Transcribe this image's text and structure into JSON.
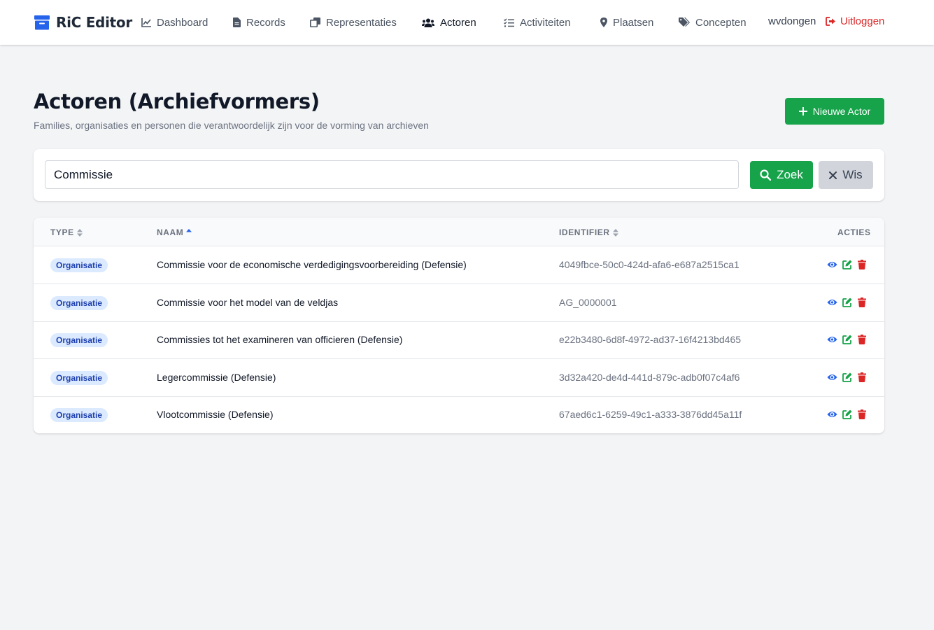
{
  "app": {
    "name": "RiC Editor"
  },
  "nav": {
    "items": [
      {
        "label": "Dashboard",
        "icon": "chart-line-icon"
      },
      {
        "label": "Records",
        "icon": "file-icon"
      },
      {
        "label": "Representaties",
        "icon": "copy-icon"
      },
      {
        "label": "Actoren",
        "icon": "users-icon",
        "active": true
      },
      {
        "label": "Activiteiten",
        "icon": "tasks-icon"
      },
      {
        "label": "Plaatsen",
        "icon": "map-marker-icon"
      },
      {
        "label": "Concepten",
        "icon": "tags-icon"
      }
    ],
    "user": "wvdongen",
    "logout": "Uitloggen"
  },
  "page": {
    "title": "Actoren (Archiefvormers)",
    "subtitle": "Families, organisaties en personen die verantwoordelijk zijn voor de vorming van archieven",
    "new_button": "Nieuwe Actor"
  },
  "search": {
    "value": "Commissie",
    "search_button": "Zoek",
    "clear_button": "Wis"
  },
  "table": {
    "columns": [
      "TYPE",
      "NAAM",
      "IDENTIFIER",
      "ACTIES"
    ],
    "rows": [
      {
        "type": "Organisatie",
        "name": "Commissie voor de economische verdedigingsvoorbereiding (Defensie)",
        "identifier": "4049fbce-50c0-424d-afa6-e687a2515ca1"
      },
      {
        "type": "Organisatie",
        "name": "Commissie voor het model van de veldjas",
        "identifier": "AG_0000001"
      },
      {
        "type": "Organisatie",
        "name": "Commissies tot het examineren van officieren (Defensie)",
        "identifier": "e22b3480-6d8f-4972-ad37-16f4213bd465"
      },
      {
        "type": "Organisatie",
        "name": "Legercommissie (Defensie)",
        "identifier": "3d32a420-de4d-441d-879c-adb0f07c4af6"
      },
      {
        "type": "Organisatie",
        "name": "Vlootcommissie (Defensie)",
        "identifier": "67aed6c1-6259-49c1-a333-3876dd45a11f"
      }
    ]
  },
  "colors": {
    "brand": "#2563eb",
    "primary_green": "#16a34a",
    "danger_red": "#dc2626",
    "badge_bg": "#dbeafe",
    "badge_text": "#1e40af"
  }
}
